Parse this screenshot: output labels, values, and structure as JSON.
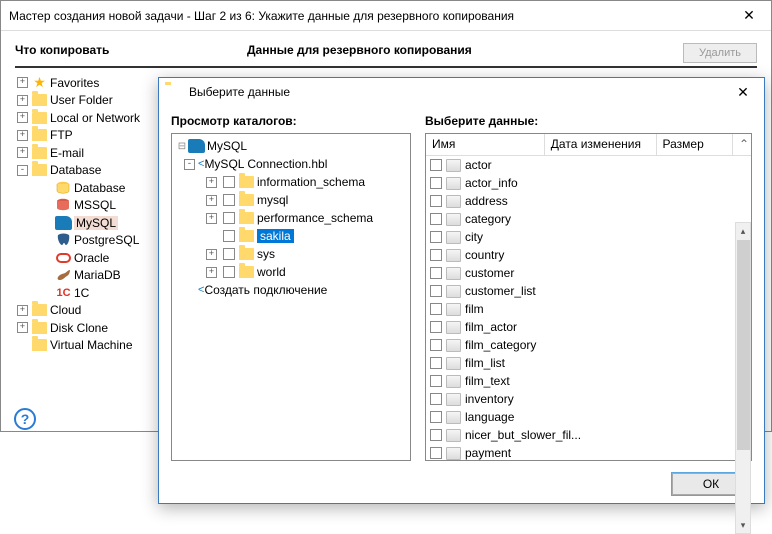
{
  "wizard": {
    "title": "Мастер создания новой задачи - Шаг 2 из 6: Укажите данные для резервного копирования",
    "col_what": "Что копировать",
    "col_data": "Данные для резервного копирования",
    "delete_btn": "Удалить"
  },
  "left_tree": [
    {
      "exp": "+",
      "icon": "star",
      "label": "Favorites",
      "indent": 0
    },
    {
      "exp": "+",
      "icon": "folder",
      "label": "User Folder",
      "indent": 0
    },
    {
      "exp": "+",
      "icon": "folder",
      "label": "Local or Network",
      "indent": 0
    },
    {
      "exp": "+",
      "icon": "folder",
      "label": "FTP",
      "indent": 0
    },
    {
      "exp": "+",
      "icon": "folder",
      "label": "E-mail",
      "indent": 0
    },
    {
      "exp": "-",
      "icon": "folder",
      "label": "Database",
      "indent": 0
    },
    {
      "exp": "",
      "icon": "db",
      "label": "Database",
      "indent": 1
    },
    {
      "exp": "",
      "icon": "mssql",
      "label": "MSSQL",
      "indent": 1
    },
    {
      "exp": "",
      "icon": "mysql",
      "label": "MySQL",
      "indent": 1,
      "selected": true
    },
    {
      "exp": "",
      "icon": "pg",
      "label": "PostgreSQL",
      "indent": 1
    },
    {
      "exp": "",
      "icon": "oracle",
      "label": "Oracle",
      "indent": 1
    },
    {
      "exp": "",
      "icon": "mariadb",
      "label": "MariaDB",
      "indent": 1
    },
    {
      "exp": "",
      "icon": "1c",
      "label": "1C",
      "indent": 1
    },
    {
      "exp": "+",
      "icon": "folder",
      "label": "Cloud",
      "indent": 0
    },
    {
      "exp": "+",
      "icon": "folder",
      "label": "Disk Clone",
      "indent": 0
    },
    {
      "exp": " ",
      "icon": "folder",
      "label": "Virtual Machine",
      "indent": 0
    }
  ],
  "modal": {
    "title": "Выберите данные",
    "browse_label": "Просмотр каталогов:",
    "select_label": "Выберите данные:",
    "col_name": "Имя",
    "col_date": "Дата изменения",
    "col_size": "Размер",
    "ok": "ОК"
  },
  "catalog": {
    "root": "MySQL",
    "conn": "MySQL Connection.hbl",
    "dbs": [
      {
        "label": "information_schema",
        "exp": "+"
      },
      {
        "label": "mysql",
        "exp": "+"
      },
      {
        "label": "performance_schema",
        "exp": "+"
      },
      {
        "label": "sakila",
        "exp": "",
        "selected": true
      },
      {
        "label": "sys",
        "exp": "+"
      },
      {
        "label": "world",
        "exp": "+"
      }
    ],
    "create_conn": "Создать подключение"
  },
  "items": [
    "actor",
    "actor_info",
    "address",
    "category",
    "city",
    "country",
    "customer",
    "customer_list",
    "film",
    "film_actor",
    "film_category",
    "film_list",
    "film_text",
    "inventory",
    "language",
    "nicer_but_slower_fil...",
    "payment"
  ]
}
